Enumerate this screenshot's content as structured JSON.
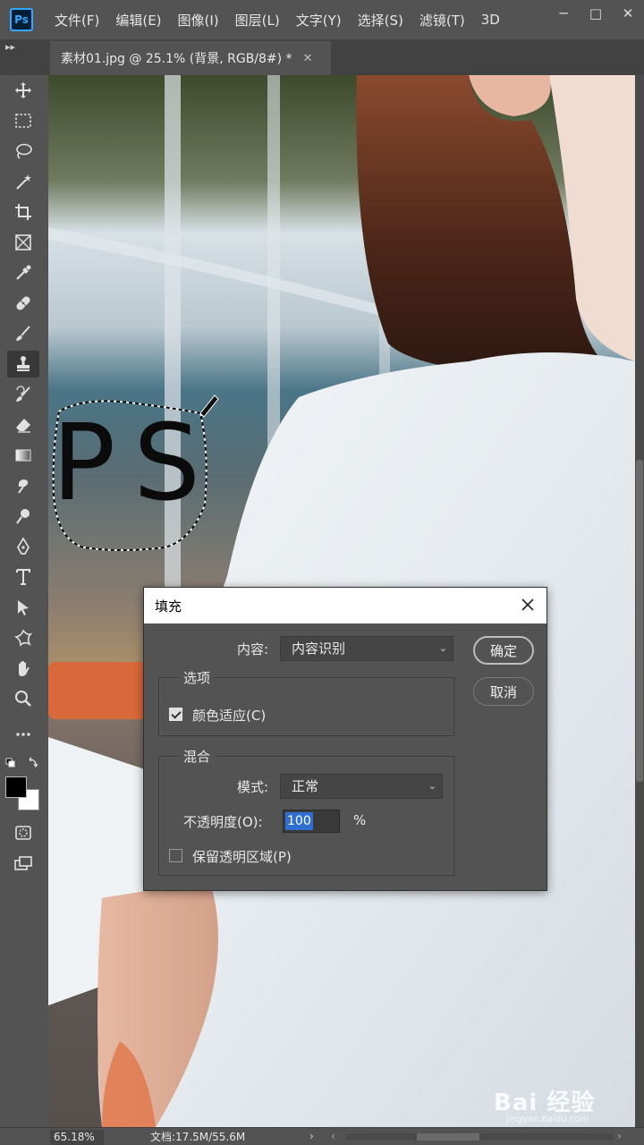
{
  "menubar": {
    "logo": "Ps",
    "items": [
      "文件(F)",
      "编辑(E)",
      "图像(I)",
      "图层(L)",
      "文字(Y)",
      "选择(S)",
      "滤镜(T)",
      "3D"
    ],
    "window_controls": {
      "minimize": "─",
      "maximize": "□",
      "close": "✕"
    }
  },
  "tabs": {
    "collapse_arrows": "▸▸",
    "document": {
      "title": "素材01.jpg @ 25.1% (背景, RGB/8#) *",
      "close": "✕"
    }
  },
  "toolbar": {
    "tools": [
      "move-icon",
      "marquee-icon",
      "lasso-icon",
      "magic-wand-icon",
      "crop-icon",
      "frame-icon",
      "eyedropper-icon",
      "healing-brush-icon",
      "brush-icon",
      "clone-stamp-icon",
      "history-brush-icon",
      "eraser-icon",
      "gradient-icon",
      "smudge-icon",
      "dodge-icon",
      "pen-icon",
      "type-icon",
      "path-selection-icon",
      "custom-shape-icon",
      "hand-icon",
      "zoom-icon",
      "more-tools-icon"
    ],
    "active_tool": "clone-stamp-icon",
    "foreground_color": "#000000",
    "background_color": "#ffffff"
  },
  "canvas": {
    "overlay_text": "PS"
  },
  "dialog": {
    "title": "填充",
    "close": "✕",
    "content_label": "内容:",
    "content_value": "内容识别",
    "options_title": "选项",
    "color_adapt_label": "颜色适应(C)",
    "color_adapt_checked": true,
    "blend_title": "混合",
    "mode_label": "模式:",
    "mode_value": "正常",
    "opacity_label": "不透明度(O):",
    "opacity_value": "100",
    "opacity_unit": "%",
    "preserve_label": "保留透明区域(P)",
    "preserve_checked": false,
    "ok_label": "确定",
    "cancel_label": "取消"
  },
  "status": {
    "zoom": "65.18%",
    "doc_size": "文档:17.5M/55.6M",
    "arrow": "›"
  },
  "watermark": {
    "brand": "Bai 经验",
    "url": "jingyan.baidu.com"
  },
  "colors": {
    "ui_bg": "#535353",
    "panel_dark": "#424242",
    "selection_blue": "#2f6fd1",
    "ps_logo_blue": "#31a8ff"
  }
}
